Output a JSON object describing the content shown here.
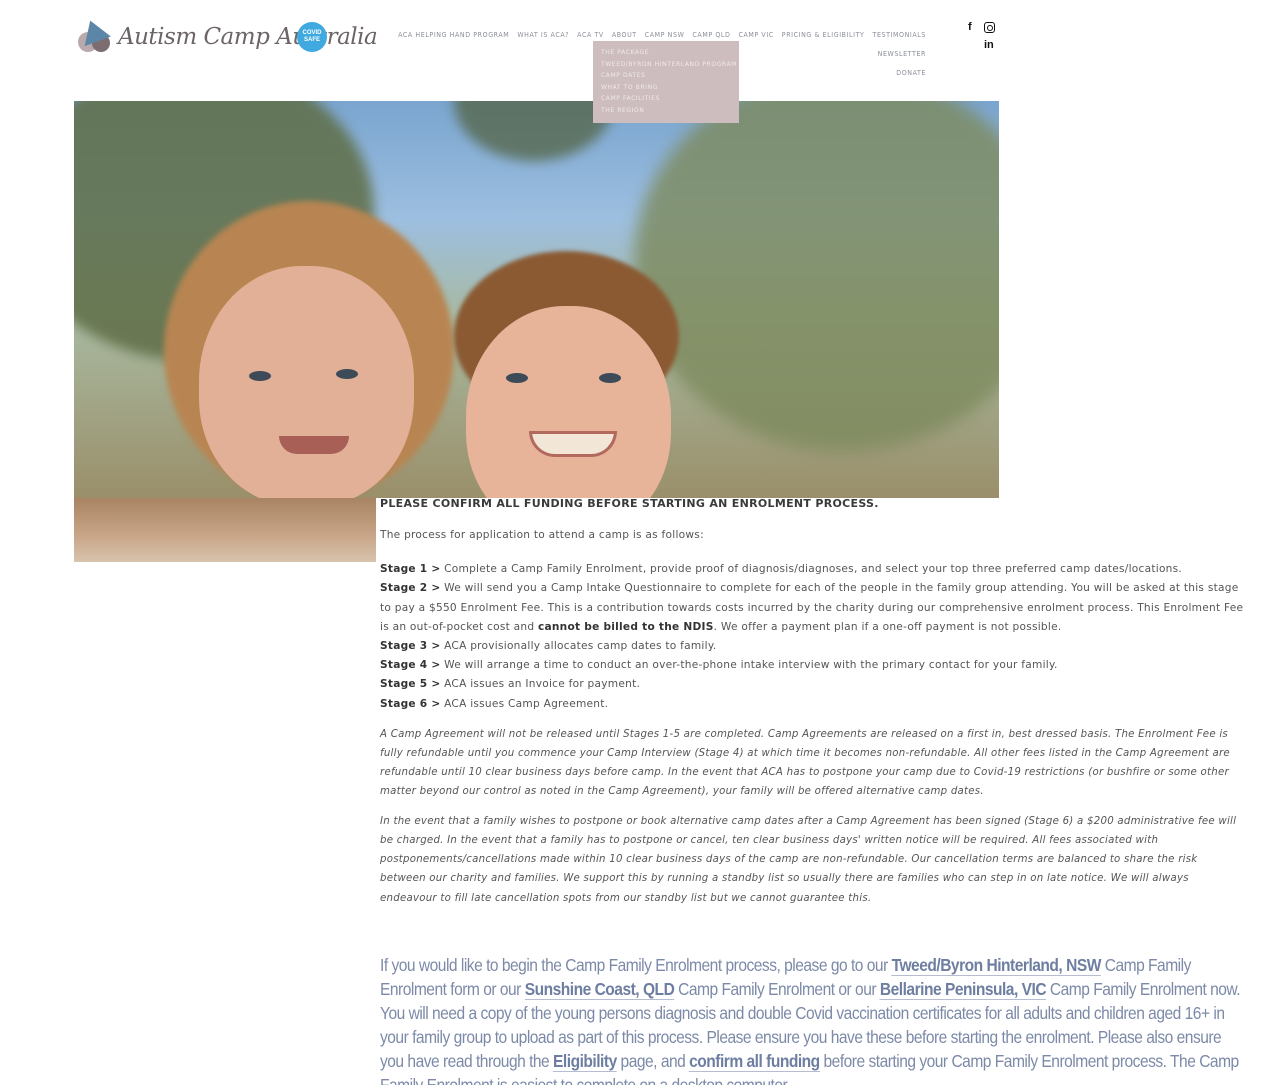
{
  "header": {
    "logo_text": "Autism Camp Australia",
    "covid_badge": "COVID SAFE",
    "nav": [
      "ACA Helping Hand Program",
      "What is ACA?",
      "ACA TV",
      "About",
      "Camp NSW",
      "Camp QLD",
      "Camp VIC",
      "Pricing & Eligibility",
      "Testimonials",
      "Newsletter",
      "Donate"
    ],
    "dropdown_camp_nsw": [
      "The Package",
      "Tweed/Byron Hinterland Program",
      "Camp Dates",
      "What to Bring",
      "Camp Facilities",
      "The Region"
    ],
    "social": [
      "facebook-icon",
      "instagram-icon",
      "linkedin-icon"
    ]
  },
  "content": {
    "lead": "PLEASE CONFIRM ALL FUNDING BEFORE STARTING AN ENROLMENT PROCESS.",
    "intro": "The process for application to attend a camp is as follows:",
    "stages": [
      {
        "label": "Stage 1 >",
        "text": " Complete a Camp Family Enrolment, provide proof of diagnosis/diagnoses, and select your top three preferred camp dates/locations."
      },
      {
        "label": "Stage 2 >",
        "text": " We will send you a Camp Intake Questionnaire to complete for each of the people in the family group attending. You will be asked at this stage to pay a $550 Enrolment Fee. This is a contribution towards costs incurred by the charity during our comprehensive enrolment process. This Enrolment Fee is an out-of-pocket cost and ",
        "bold": "cannot be billed to the NDIS",
        "after": ". We offer a payment plan if a one-off payment is not possible."
      },
      {
        "label": "Stage 3 >",
        "text": " ACA provisionally allocates camp dates to family."
      },
      {
        "label": "Stage 4 >",
        "text": " We will arrange a time to conduct an over-the-phone intake interview with the primary contact for your family."
      },
      {
        "label": "Stage 5 >",
        "text": " ACA issues an Invoice for payment."
      },
      {
        "label": "Stage 6 >",
        "text": " ACA issues Camp Agreement."
      }
    ],
    "note_1": "A Camp Agreement will not be released until Stages 1-5 are completed. Camp Agreements are released on a first in, best dressed basis. The Enrolment Fee is fully refundable until you commence your Camp Interview (Stage 4) at which time it becomes non-refundable. All other fees listed in the Camp Agreement are refundable until 10 clear business days before camp. In the event that ACA has to postpone your camp due to Covid-19 restrictions (or bushfire or some other matter beyond our control as noted in the Camp Agreement), your family will be offered alternative camp dates.",
    "note_2": "In the event that a family wishes to postpone or book alternative camp dates after a Camp Agreement has been signed (Stage 6) a $200 administrative fee will be charged. In the event that a family has to postpone or cancel, ten clear business days' written notice will be required. All fees associated with postponements/cancellations made within 10 clear business days of the camp are non-refundable. Our cancellation terms are balanced to share the risk between our charity and families. We support this by running a standby list so usually there are families who can step in on late notice. We will always endeavour to fill late cancellation spots from our standby list but we cannot guarantee this.",
    "cta": {
      "t1": "If you would like to begin the Camp Family Enrolment process, please go to our ",
      "link_nsw": "Tweed/Byron Hinterland, NSW",
      "t2": " Camp Family Enrolment form or our ",
      "link_qld": "Sunshine Coast, QLD",
      "t3": " Camp Family Enrolment  or our ",
      "link_vic": "Bellarine Peninsula, VIC",
      "t4": " Camp Family Enrolment now.  You will need a copy of the young persons diagnosis and double Covid vaccination certificates for all adults and children aged 16+ in your family group to upload as part of this process. Please ensure you have these before starting the enrolment. Please also ensure you have read through the ",
      "link_elig": "Eligibility",
      "t5": " page, and ",
      "link_funding": "confirm all funding",
      "t6": " before starting your Camp Family Enrolment process. The Camp Family Enrolment is easiest to complete on a desktop computer."
    }
  }
}
